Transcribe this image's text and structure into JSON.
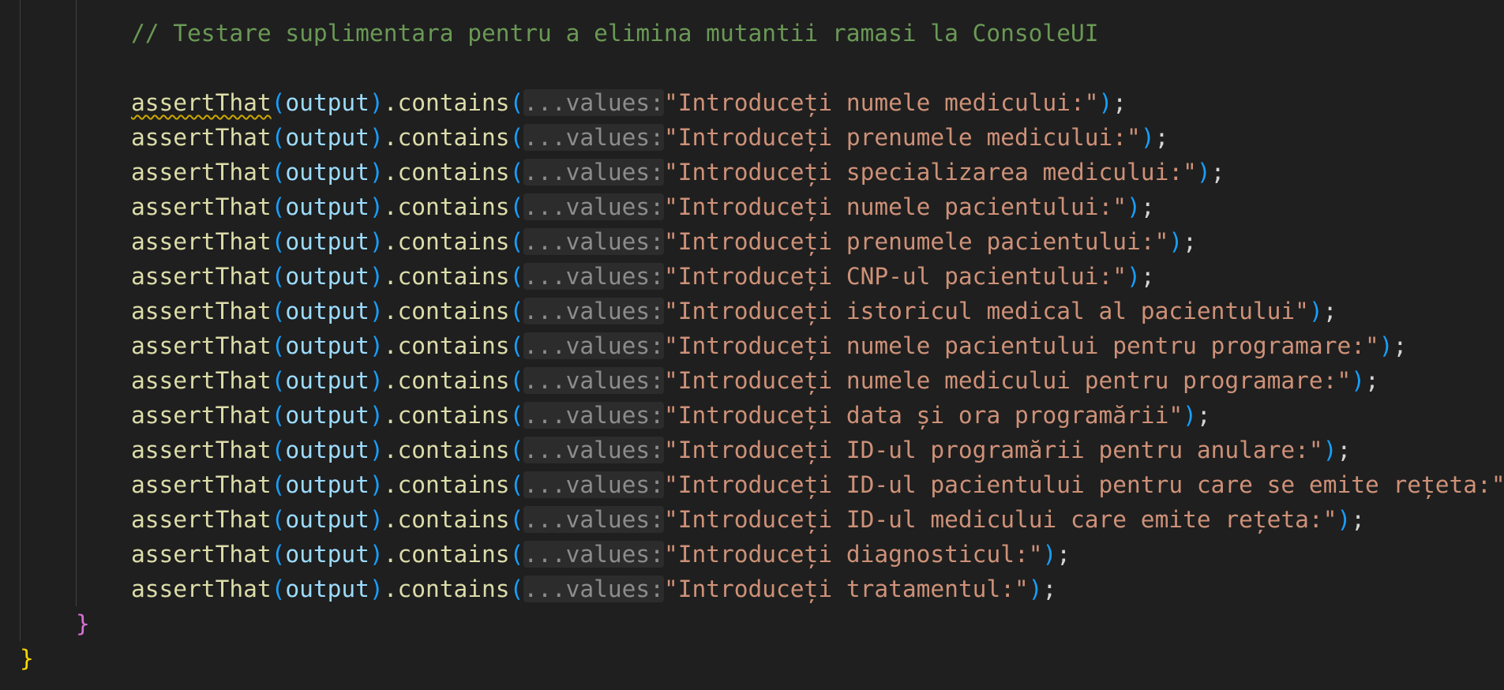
{
  "comment": "// Testare suplimentara pentru a elimina mutantii ramasi la ConsoleUI",
  "assert_fn": "assertThat",
  "arg": "output",
  "method": ".contains",
  "hint": "...values:",
  "open_paren": "(",
  "close_paren": ")",
  "semicolon": ";",
  "strings": [
    "\"Introduceți numele medicului:\"",
    "\"Introduceți prenumele medicului:\"",
    "\"Introduceți specializarea medicului:\"",
    "\"Introduceți numele pacientului:\"",
    "\"Introduceți prenumele pacientului:\"",
    "\"Introduceți CNP-ul pacientului:\"",
    "\"Introduceți istoricul medical al pacientului\"",
    "\"Introduceți numele pacientului pentru programare:\"",
    "\"Introduceți numele medicului pentru programare:\"",
    "\"Introduceți data și ora programării\"",
    "\"Introduceți ID-ul programării pentru anulare:\"",
    "\"Introduceți ID-ul pacientului pentru care se emite rețeta:\"",
    "\"Introduceți ID-ul medicului care emite rețeta:\"",
    "\"Introduceți diagnosticul:\"",
    "\"Introduceți tratamentul:\""
  ],
  "brace_inner": "}",
  "brace_outer": "}",
  "colors": {
    "background": "#1f1f1f",
    "comment": "#6a9955",
    "function": "#dcdcaa",
    "variable": "#9cdcfe",
    "paren": "#179fff",
    "string": "#ce9178",
    "inlay_hint": "#8c8c8c",
    "brace_inner": "#da70d6",
    "brace_outer": "#ffd700",
    "warning_squiggle": "#cca700"
  }
}
